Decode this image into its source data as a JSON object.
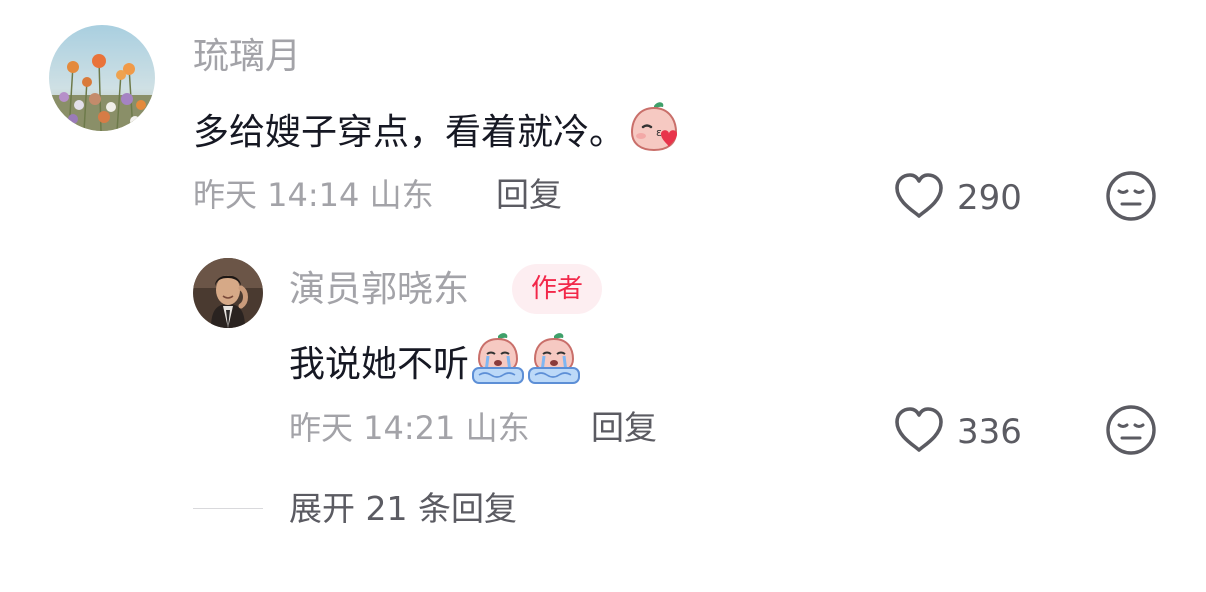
{
  "comment": {
    "username": "琉璃月",
    "text": "多给嫂子穿点，看着就冷。",
    "emoji_icon": "blushing-kiss-peach-emoji",
    "time": "昨天 14:14 山东",
    "reply_label": "回复",
    "like_count": "290",
    "avatar_icon": "flower-field-avatar"
  },
  "reply": {
    "username": "演员郭晓东",
    "badge": "作者",
    "text": "我说她不听",
    "emoji_icons": [
      "crying-peach-emoji",
      "crying-peach-emoji"
    ],
    "time": "昨天 14:21 山东",
    "reply_label": "回复",
    "like_count": "336",
    "avatar_icon": "man-portrait-avatar"
  },
  "expand": {
    "label": "展开 21 条回复"
  },
  "colors": {
    "muted_text": "#a3a3a8",
    "primary_text": "#161823",
    "secondary_text": "#5b5b62",
    "author_badge_bg": "#fdeef1",
    "author_badge_text": "#f2284a"
  }
}
